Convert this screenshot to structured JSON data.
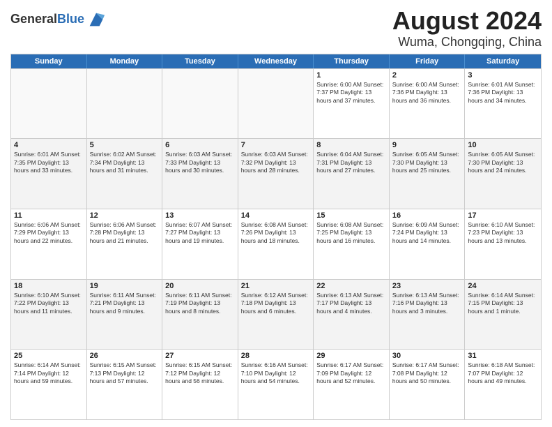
{
  "header": {
    "logo_general": "General",
    "logo_blue": "Blue",
    "title": "August 2024",
    "subtitle": "Wuma, Chongqing, China"
  },
  "calendar": {
    "days_of_week": [
      "Sunday",
      "Monday",
      "Tuesday",
      "Wednesday",
      "Thursday",
      "Friday",
      "Saturday"
    ],
    "weeks": [
      [
        {
          "day": "",
          "info": "",
          "empty": true
        },
        {
          "day": "",
          "info": "",
          "empty": true
        },
        {
          "day": "",
          "info": "",
          "empty": true
        },
        {
          "day": "",
          "info": "",
          "empty": true
        },
        {
          "day": "1",
          "info": "Sunrise: 6:00 AM\nSunset: 7:37 PM\nDaylight: 13 hours and 37 minutes.",
          "empty": false
        },
        {
          "day": "2",
          "info": "Sunrise: 6:00 AM\nSunset: 7:36 PM\nDaylight: 13 hours and 36 minutes.",
          "empty": false
        },
        {
          "day": "3",
          "info": "Sunrise: 6:01 AM\nSunset: 7:36 PM\nDaylight: 13 hours and 34 minutes.",
          "empty": false
        }
      ],
      [
        {
          "day": "4",
          "info": "Sunrise: 6:01 AM\nSunset: 7:35 PM\nDaylight: 13 hours and 33 minutes.",
          "empty": false
        },
        {
          "day": "5",
          "info": "Sunrise: 6:02 AM\nSunset: 7:34 PM\nDaylight: 13 hours and 31 minutes.",
          "empty": false
        },
        {
          "day": "6",
          "info": "Sunrise: 6:03 AM\nSunset: 7:33 PM\nDaylight: 13 hours and 30 minutes.",
          "empty": false
        },
        {
          "day": "7",
          "info": "Sunrise: 6:03 AM\nSunset: 7:32 PM\nDaylight: 13 hours and 28 minutes.",
          "empty": false
        },
        {
          "day": "8",
          "info": "Sunrise: 6:04 AM\nSunset: 7:31 PM\nDaylight: 13 hours and 27 minutes.",
          "empty": false
        },
        {
          "day": "9",
          "info": "Sunrise: 6:05 AM\nSunset: 7:30 PM\nDaylight: 13 hours and 25 minutes.",
          "empty": false
        },
        {
          "day": "10",
          "info": "Sunrise: 6:05 AM\nSunset: 7:30 PM\nDaylight: 13 hours and 24 minutes.",
          "empty": false
        }
      ],
      [
        {
          "day": "11",
          "info": "Sunrise: 6:06 AM\nSunset: 7:29 PM\nDaylight: 13 hours and 22 minutes.",
          "empty": false
        },
        {
          "day": "12",
          "info": "Sunrise: 6:06 AM\nSunset: 7:28 PM\nDaylight: 13 hours and 21 minutes.",
          "empty": false
        },
        {
          "day": "13",
          "info": "Sunrise: 6:07 AM\nSunset: 7:27 PM\nDaylight: 13 hours and 19 minutes.",
          "empty": false
        },
        {
          "day": "14",
          "info": "Sunrise: 6:08 AM\nSunset: 7:26 PM\nDaylight: 13 hours and 18 minutes.",
          "empty": false
        },
        {
          "day": "15",
          "info": "Sunrise: 6:08 AM\nSunset: 7:25 PM\nDaylight: 13 hours and 16 minutes.",
          "empty": false
        },
        {
          "day": "16",
          "info": "Sunrise: 6:09 AM\nSunset: 7:24 PM\nDaylight: 13 hours and 14 minutes.",
          "empty": false
        },
        {
          "day": "17",
          "info": "Sunrise: 6:10 AM\nSunset: 7:23 PM\nDaylight: 13 hours and 13 minutes.",
          "empty": false
        }
      ],
      [
        {
          "day": "18",
          "info": "Sunrise: 6:10 AM\nSunset: 7:22 PM\nDaylight: 13 hours and 11 minutes.",
          "empty": false
        },
        {
          "day": "19",
          "info": "Sunrise: 6:11 AM\nSunset: 7:21 PM\nDaylight: 13 hours and 9 minutes.",
          "empty": false
        },
        {
          "day": "20",
          "info": "Sunrise: 6:11 AM\nSunset: 7:19 PM\nDaylight: 13 hours and 8 minutes.",
          "empty": false
        },
        {
          "day": "21",
          "info": "Sunrise: 6:12 AM\nSunset: 7:18 PM\nDaylight: 13 hours and 6 minutes.",
          "empty": false
        },
        {
          "day": "22",
          "info": "Sunrise: 6:13 AM\nSunset: 7:17 PM\nDaylight: 13 hours and 4 minutes.",
          "empty": false
        },
        {
          "day": "23",
          "info": "Sunrise: 6:13 AM\nSunset: 7:16 PM\nDaylight: 13 hours and 3 minutes.",
          "empty": false
        },
        {
          "day": "24",
          "info": "Sunrise: 6:14 AM\nSunset: 7:15 PM\nDaylight: 13 hours and 1 minute.",
          "empty": false
        }
      ],
      [
        {
          "day": "25",
          "info": "Sunrise: 6:14 AM\nSunset: 7:14 PM\nDaylight: 12 hours and 59 minutes.",
          "empty": false
        },
        {
          "day": "26",
          "info": "Sunrise: 6:15 AM\nSunset: 7:13 PM\nDaylight: 12 hours and 57 minutes.",
          "empty": false
        },
        {
          "day": "27",
          "info": "Sunrise: 6:15 AM\nSunset: 7:12 PM\nDaylight: 12 hours and 56 minutes.",
          "empty": false
        },
        {
          "day": "28",
          "info": "Sunrise: 6:16 AM\nSunset: 7:10 PM\nDaylight: 12 hours and 54 minutes.",
          "empty": false
        },
        {
          "day": "29",
          "info": "Sunrise: 6:17 AM\nSunset: 7:09 PM\nDaylight: 12 hours and 52 minutes.",
          "empty": false
        },
        {
          "day": "30",
          "info": "Sunrise: 6:17 AM\nSunset: 7:08 PM\nDaylight: 12 hours and 50 minutes.",
          "empty": false
        },
        {
          "day": "31",
          "info": "Sunrise: 6:18 AM\nSunset: 7:07 PM\nDaylight: 12 hours and 49 minutes.",
          "empty": false
        }
      ]
    ]
  }
}
